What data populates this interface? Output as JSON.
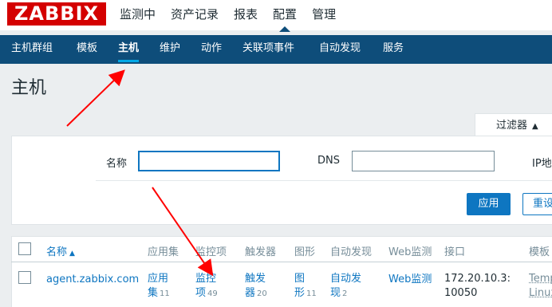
{
  "app": {
    "logo": "ZABBIX"
  },
  "top_menu": [
    {
      "label": "监测中",
      "selected": false
    },
    {
      "label": "资产记录",
      "selected": false
    },
    {
      "label": "报表",
      "selected": false
    },
    {
      "label": "配置",
      "selected": true
    },
    {
      "label": "管理",
      "selected": false
    }
  ],
  "sub_menu": [
    {
      "label": "主机群组",
      "selected": false
    },
    {
      "label": "模板",
      "selected": false
    },
    {
      "label": "主机",
      "selected": true
    },
    {
      "label": "维护",
      "selected": false
    },
    {
      "label": "动作",
      "selected": false
    },
    {
      "label": "关联项事件",
      "selected": false
    },
    {
      "label": "自动发现",
      "selected": false
    },
    {
      "label": "服务",
      "selected": false
    }
  ],
  "page": {
    "title": "主机"
  },
  "filter": {
    "tab_label": "过滤器",
    "tab_arrow": "▲",
    "name_label": "名称",
    "name_value": "",
    "dns_label": "DNS",
    "dns_value": "",
    "ip_label": "IP地址",
    "apply_label": "应用",
    "reset_label": "重设"
  },
  "table": {
    "headers": {
      "name": "名称",
      "sort_arrow": "▲",
      "applications": "应用集",
      "items": "监控项",
      "triggers": "触发器",
      "graphs": "图形",
      "discovery": "自动发现",
      "web": "Web监测",
      "interface": "接口",
      "templates": "模板"
    },
    "rows": [
      {
        "name": "agent.zabbix.com",
        "applications_line1": "应用",
        "applications_line2": "集",
        "applications_count": "11",
        "items_line1": "监控",
        "items_line2": "项",
        "items_count": "49",
        "triggers_line1": "触发",
        "triggers_line2": "器",
        "triggers_count": "20",
        "graphs_line1": "图",
        "graphs_line2": "形",
        "graphs_count": "11",
        "discovery_line1": "自动发",
        "discovery_line2": "现",
        "discovery_count": "2",
        "web": "Web监测",
        "interface_line1": "172.20.10.3:",
        "interface_line2": "10050",
        "templates_line1": "Temp",
        "templates_line2": "Linux"
      }
    ]
  },
  "colors": {
    "brand_red": "#d40000",
    "nav_blue": "#0e4d7a",
    "link_blue": "#0e76c1",
    "annotation_red": "#ff0000"
  }
}
